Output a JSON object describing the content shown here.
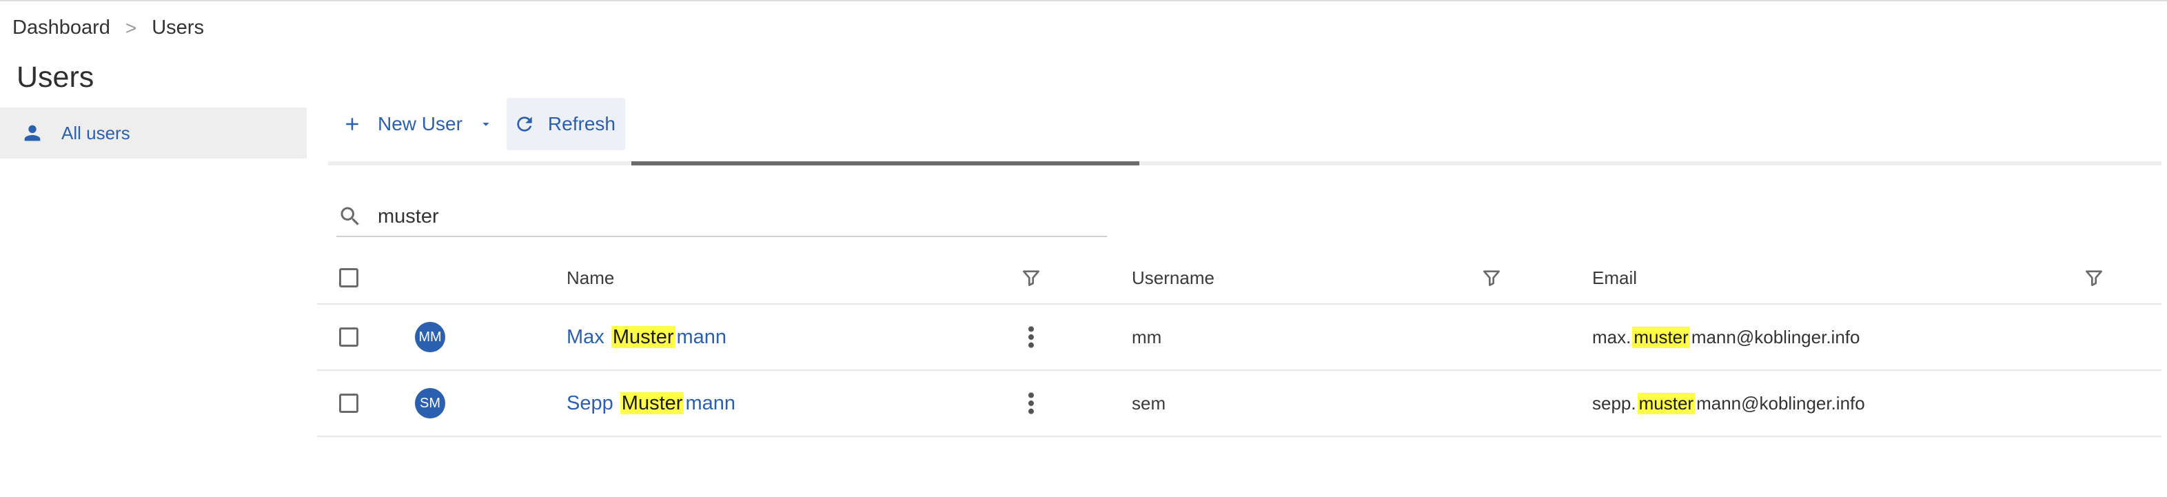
{
  "breadcrumb": {
    "items": [
      "Dashboard",
      "Users"
    ],
    "separator": ">"
  },
  "page": {
    "title": "Users"
  },
  "sidebar": {
    "items": [
      {
        "label": "All users",
        "icon": "person-icon",
        "active": true
      }
    ]
  },
  "toolbar": {
    "new_user_label": "New User",
    "refresh_label": "Refresh"
  },
  "progress": {
    "start_fraction": 0.1654,
    "end_fraction": 0.4425
  },
  "search": {
    "value": "muster",
    "placeholder": ""
  },
  "table": {
    "columns": {
      "name": "Name",
      "username": "Username",
      "email": "Email"
    },
    "rows": [
      {
        "initials": "MM",
        "name": {
          "pre": "Max",
          "match": "Muster",
          "post": "mann"
        },
        "username": "mm",
        "email": {
          "pre": "max.",
          "match": "muster",
          "post": "mann@koblinger.info"
        }
      },
      {
        "initials": "SM",
        "name": {
          "pre": "Sepp",
          "match": "Muster",
          "post": "mann"
        },
        "username": "sem",
        "email": {
          "pre": "sepp.",
          "match": "muster",
          "post": "mann@koblinger.info"
        }
      }
    ]
  },
  "colors": {
    "accent": "#2b5fb0",
    "highlight": "#ffff47",
    "sidebar_active_bg": "#eeeeee",
    "progress": "#6b6b6b"
  }
}
